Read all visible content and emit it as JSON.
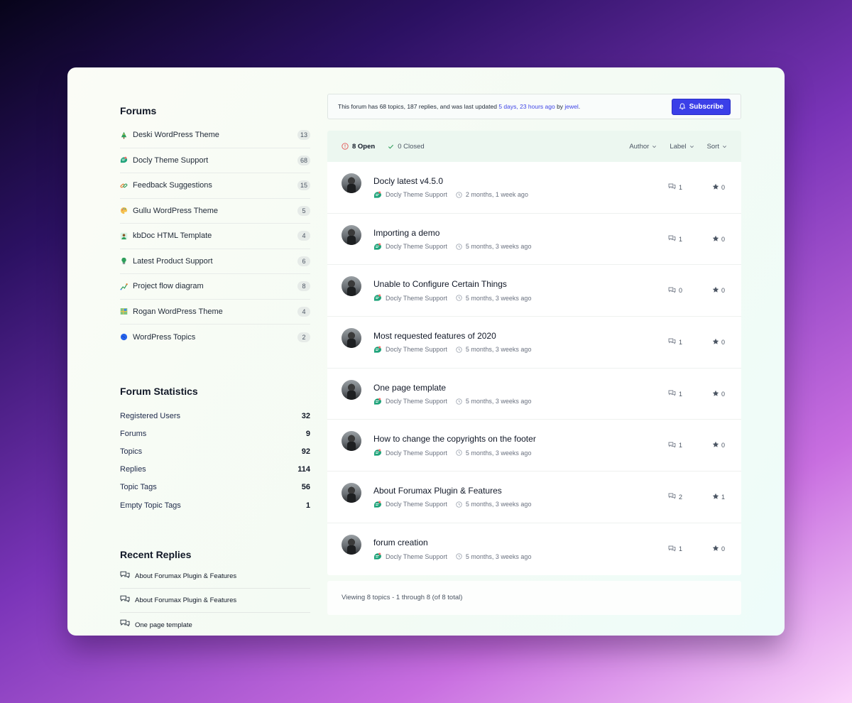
{
  "sidebar": {
    "forums_title": "Forums",
    "forums": [
      {
        "name": "Deski WordPress Theme",
        "count": "13",
        "icon": "tree-icon"
      },
      {
        "name": "Docly Theme Support",
        "count": "68",
        "icon": "docly-icon"
      },
      {
        "name": "Feedback Suggestions",
        "count": "15",
        "icon": "link-icon"
      },
      {
        "name": "Gullu WordPress Theme",
        "count": "5",
        "icon": "palette-icon"
      },
      {
        "name": "kbDoc HTML Template",
        "count": "4",
        "icon": "person-icon"
      },
      {
        "name": "Latest Product Support",
        "count": "6",
        "icon": "bulb-icon"
      },
      {
        "name": "Project flow diagram",
        "count": "8",
        "icon": "graph-icon"
      },
      {
        "name": "Rogan WordPress Theme",
        "count": "4",
        "icon": "map-icon"
      },
      {
        "name": "WordPress Topics",
        "count": "2",
        "icon": "globe-icon"
      }
    ],
    "stats_title": "Forum Statistics",
    "stats": [
      {
        "label": "Registered Users",
        "value": "32"
      },
      {
        "label": "Forums",
        "value": "9"
      },
      {
        "label": "Topics",
        "value": "92"
      },
      {
        "label": "Replies",
        "value": "114"
      },
      {
        "label": "Topic Tags",
        "value": "56"
      },
      {
        "label": "Empty Topic Tags",
        "value": "1"
      }
    ],
    "recent_title": "Recent Replies",
    "recent": [
      {
        "title": "About Forumax Plugin & Features"
      },
      {
        "title": "About Forumax Plugin & Features"
      },
      {
        "title": "One page template"
      }
    ]
  },
  "info": {
    "prefix": "This forum has 68 topics, 187 replies, and was last updated ",
    "updated": "5 days, 23 hours ago",
    "by": " by ",
    "author": "jewel",
    "suffix": ".",
    "subscribe_label": "Subscribe"
  },
  "topics_header": {
    "open": "8 Open",
    "closed": "0 Closed",
    "author": "Author",
    "label": "Label",
    "sort": "Sort"
  },
  "topics": [
    {
      "title": "Docly latest v4.5.0",
      "forum": "Docly Theme Support",
      "time": "2 months, 1 week ago",
      "replies": "1",
      "votes": "0"
    },
    {
      "title": "Importing a demo",
      "forum": "Docly Theme Support",
      "time": "5 months, 3 weeks ago",
      "replies": "1",
      "votes": "0"
    },
    {
      "title": "Unable to Configure Certain Things",
      "forum": "Docly Theme Support",
      "time": "5 months, 3 weeks ago",
      "replies": "0",
      "votes": "0"
    },
    {
      "title": "Most requested features of 2020",
      "forum": "Docly Theme Support",
      "time": "5 months, 3 weeks ago",
      "replies": "1",
      "votes": "0"
    },
    {
      "title": "One page template",
      "forum": "Docly Theme Support",
      "time": "5 months, 3 weeks ago",
      "replies": "1",
      "votes": "0"
    },
    {
      "title": "How to change the copyrights on the footer",
      "forum": "Docly Theme Support",
      "time": "5 months, 3 weeks ago",
      "replies": "1",
      "votes": "0"
    },
    {
      "title": "About Forumax Plugin & Features",
      "forum": "Docly Theme Support",
      "time": "5 months, 3 weeks ago",
      "replies": "2",
      "votes": "1"
    },
    {
      "title": "forum creation",
      "forum": "Docly Theme Support",
      "time": "5 months, 3 weeks ago",
      "replies": "1",
      "votes": "0"
    }
  ],
  "pagination": {
    "text": "Viewing 8 topics - 1 through 8 (of 8 total)"
  },
  "colors": {
    "accent": "#3b3fe8",
    "header_bg": "#ecf7f0",
    "docly_green": "#1fa37a"
  }
}
